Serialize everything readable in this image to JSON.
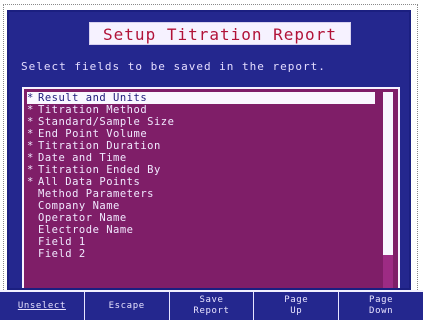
{
  "screen": {
    "title": "Setup Titration Report",
    "instruction": "Select fields to be saved in the report.",
    "list": {
      "items": [
        {
          "label": "Result and Units",
          "checked": true,
          "selected": true
        },
        {
          "label": "Titration Method",
          "checked": true,
          "selected": false
        },
        {
          "label": "Standard/Sample Size",
          "checked": true,
          "selected": false
        },
        {
          "label": "End Point Volume",
          "checked": true,
          "selected": false
        },
        {
          "label": "Titration Duration",
          "checked": true,
          "selected": false
        },
        {
          "label": "Date and Time",
          "checked": true,
          "selected": false
        },
        {
          "label": "Titration Ended By",
          "checked": true,
          "selected": false
        },
        {
          "label": "All Data Points",
          "checked": true,
          "selected": false
        },
        {
          "label": "Method Parameters",
          "checked": false,
          "selected": false
        },
        {
          "label": "Company Name",
          "checked": false,
          "selected": false
        },
        {
          "label": "Operator Name",
          "checked": false,
          "selected": false
        },
        {
          "label": "Electrode Name",
          "checked": false,
          "selected": false
        },
        {
          "label": "Field 1",
          "checked": false,
          "selected": false
        },
        {
          "label": "Field 2",
          "checked": false,
          "selected": false
        }
      ],
      "marker_glyph": "*",
      "scroll_position": 0.0,
      "scroll_visible_fraction": 0.83
    }
  },
  "softkeys": [
    {
      "label": "Unselect",
      "underlined": true
    },
    {
      "label": "Escape",
      "underlined": false
    },
    {
      "label": "Save\nReport",
      "underlined": false
    },
    {
      "label": "Page\nUp",
      "underlined": false
    },
    {
      "label": "Page\nDown",
      "underlined": false
    }
  ],
  "colors": {
    "screen_bg": "#24278e",
    "list_bg": "#7f1e68",
    "title_text": "#b11238",
    "highlight_bg": "#f9f7ff",
    "text_light": "#f1e9ff"
  }
}
